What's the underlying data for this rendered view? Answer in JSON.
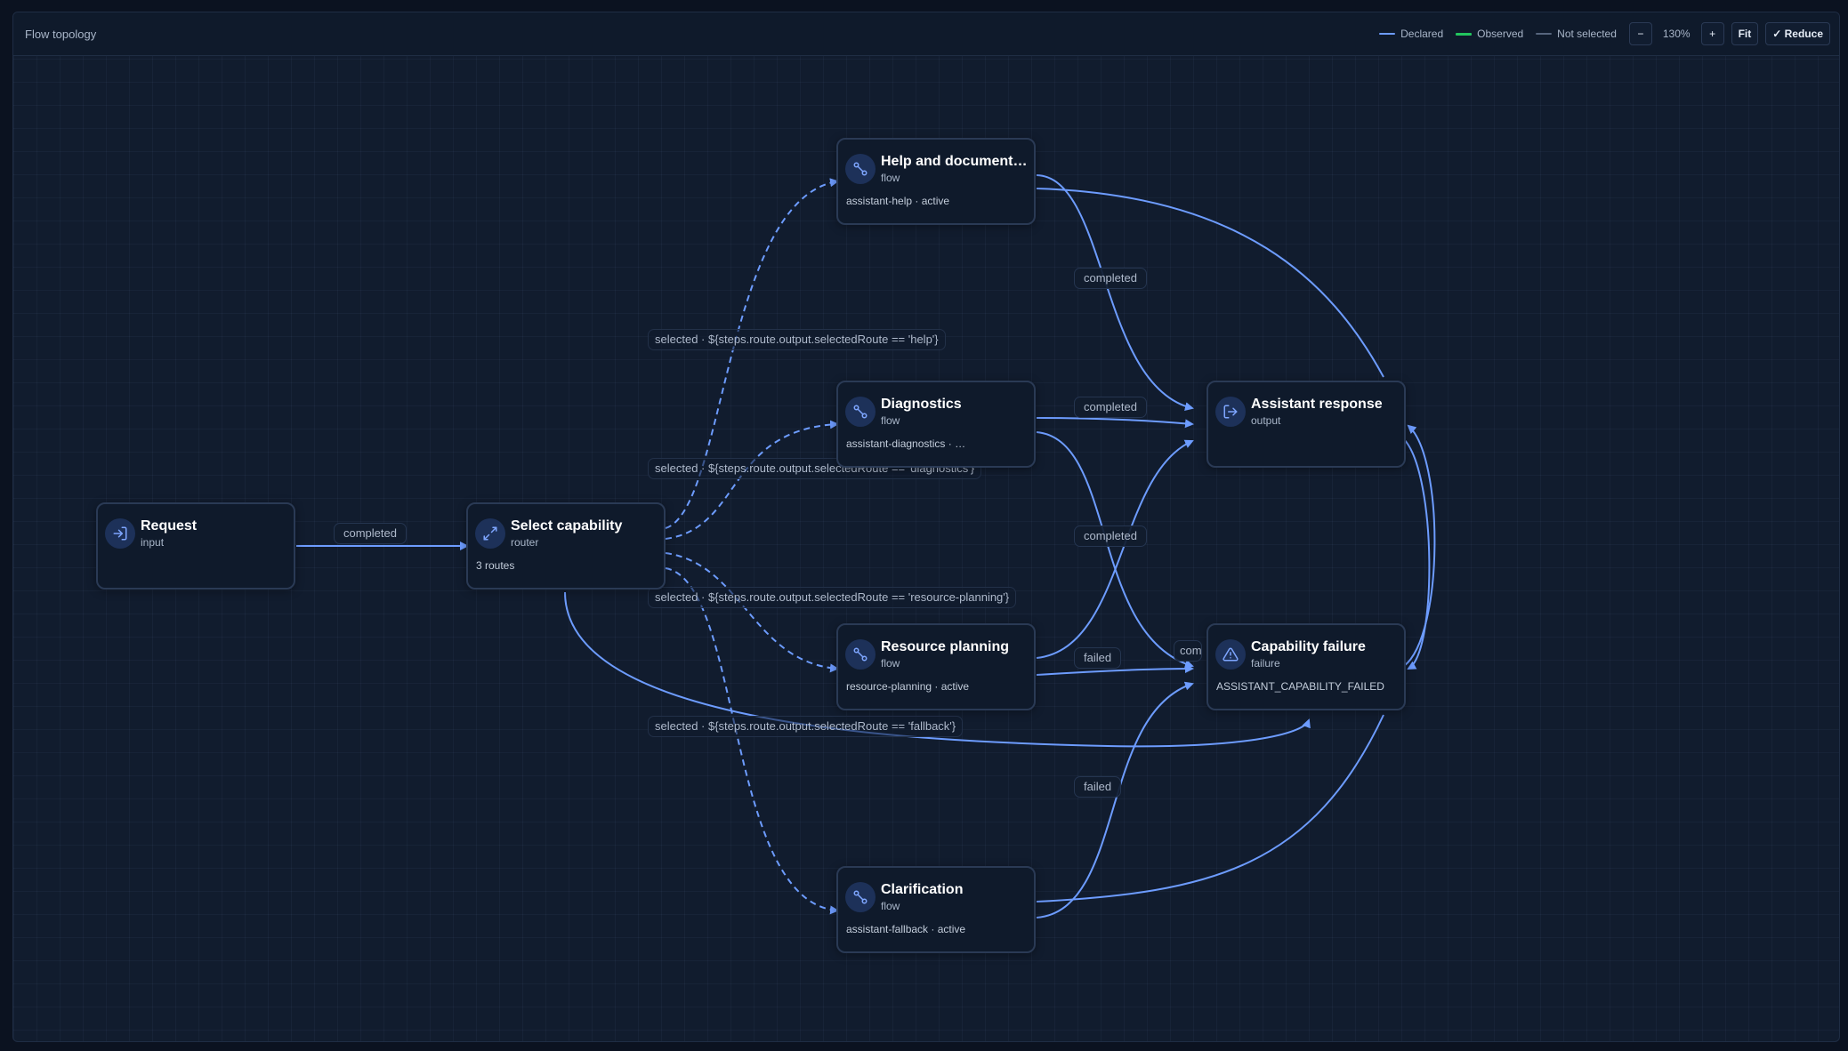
{
  "toolbar": {
    "title": "Flow topology",
    "legend": {
      "declared": "Declared",
      "observed": "Observed",
      "not_selected": "Not selected"
    },
    "zoom_out": "−",
    "zoom": "130%",
    "zoom_in": "+",
    "fit": "Fit",
    "reduce": "✓ Reduce"
  },
  "colors": {
    "declared": "#6d9cff",
    "observed": "#22c55e",
    "not_selected": "#56657d"
  },
  "nodes": {
    "request": {
      "title": "Request",
      "kind": "input",
      "icon": "log-in-icon"
    },
    "select": {
      "title": "Select capability",
      "kind": "router",
      "meta": "3 routes",
      "icon": "route-icon"
    },
    "help": {
      "title": "Help and documentation",
      "kind": "flow",
      "meta": "assistant-help · active",
      "icon": "flow-icon"
    },
    "diagnostics": {
      "title": "Diagnostics",
      "kind": "flow",
      "meta": "assistant-diagnostics · active",
      "icon": "flow-icon"
    },
    "resource": {
      "title": "Resource planning",
      "kind": "flow",
      "meta": "resource-planning · active",
      "icon": "flow-icon"
    },
    "clarification": {
      "title": "Clarification",
      "kind": "flow",
      "meta": "assistant-fallback · active",
      "icon": "flow-icon"
    },
    "response": {
      "title": "Assistant response",
      "kind": "output",
      "icon": "log-out-icon"
    },
    "failure": {
      "title": "Capability failure",
      "kind": "failure",
      "meta": "ASSISTANT_CAPABILITY_FAILED",
      "icon": "alert-triangle-icon"
    }
  },
  "edge_labels": {
    "request_select": "completed",
    "help_response": "completed",
    "diag_response": "completed",
    "resource_response": "completed",
    "resource_failure": "failed",
    "clar_failure": "failed",
    "diag_failure": "completed"
  },
  "route_labels": {
    "help": "selected · ${steps.route.output.selectedRoute == 'help'}",
    "diagnostics": "selected · ${steps.route.output.selectedRoute == 'diagnostics'}",
    "resource": "selected · ${steps.route.output.selectedRoute == 'resource-planning'}",
    "fallback": "selected · ${steps.route.output.selectedRoute == 'fallback'}"
  }
}
